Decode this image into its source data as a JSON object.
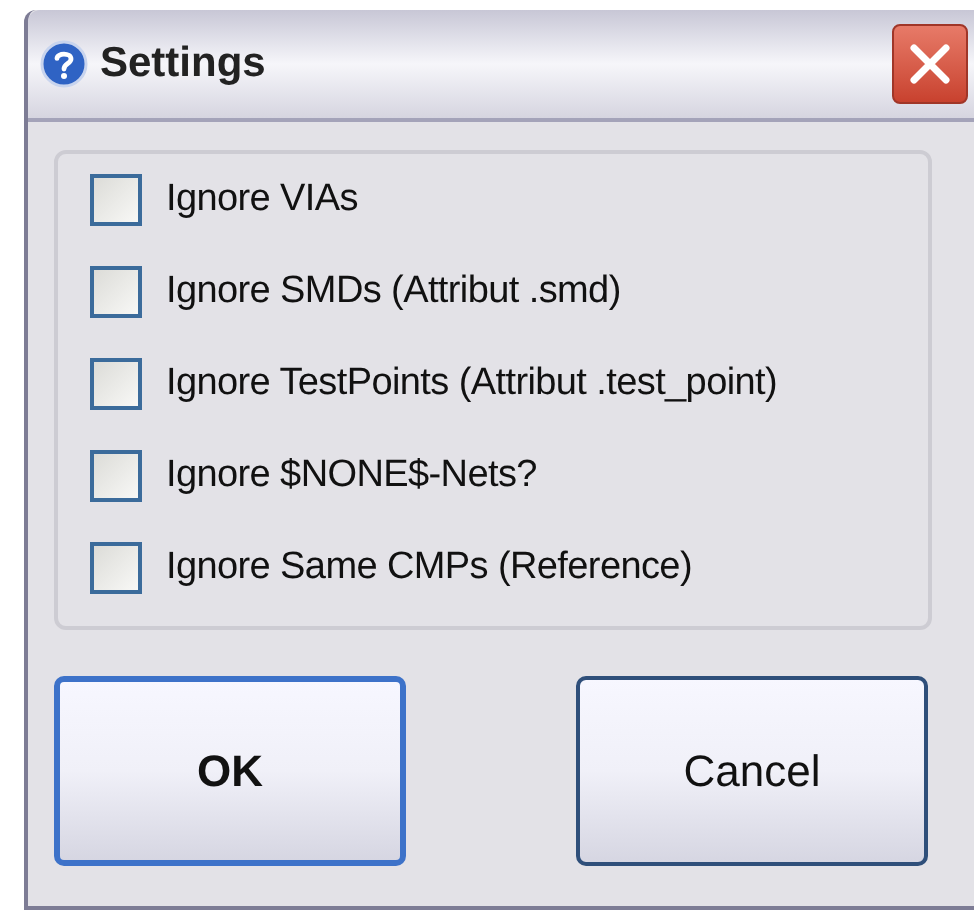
{
  "window": {
    "title": "Settings"
  },
  "options": [
    {
      "label": "Ignore VIAs",
      "checked": false
    },
    {
      "label": "Ignore SMDs (Attribut .smd)",
      "checked": false
    },
    {
      "label": "Ignore TestPoints (Attribut .test_point)",
      "checked": false
    },
    {
      "label": "Ignore $NONE$-Nets?",
      "checked": false
    },
    {
      "label": "Ignore Same CMPs (Reference)",
      "checked": false
    }
  ],
  "buttons": [
    {
      "label": "OK",
      "default": true
    },
    {
      "label": "Cancel",
      "default": false
    }
  ]
}
